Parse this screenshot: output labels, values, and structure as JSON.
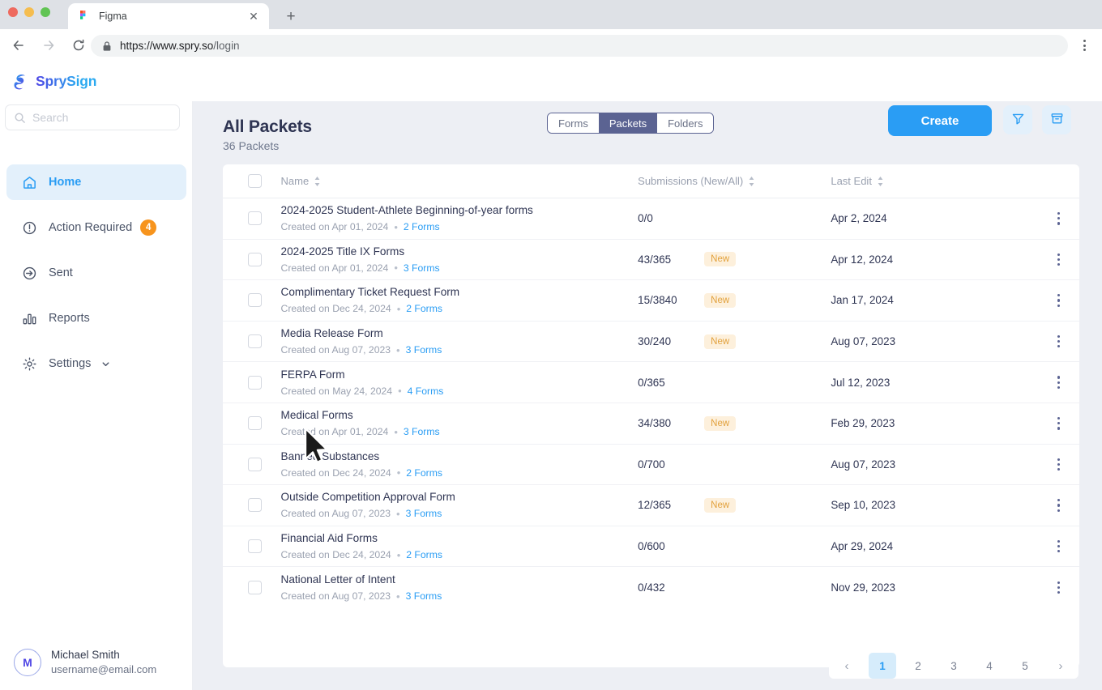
{
  "browser": {
    "tab_title": "Figma",
    "tab_favicon_icon": "figma-icon",
    "close_icon": "close-icon",
    "newtab_icon": "plus-icon",
    "back_icon": "back-arrow-icon",
    "forward_icon": "forward-arrow-icon",
    "reload_icon": "reload-icon",
    "lock_icon": "lock-icon",
    "url_prefix": "https://www.spry.so",
    "url_path": "/login",
    "menu_icon": "browser-menu-icon"
  },
  "app": {
    "brand": "SprySign",
    "brand_icon": "sprysign-logo-icon"
  },
  "sidebar": {
    "search": {
      "placeholder": "Search",
      "value": "",
      "icon": "search-icon"
    },
    "items": [
      {
        "label": "Home",
        "icon": "home-icon",
        "active": true,
        "badge": null
      },
      {
        "label": "Action Required",
        "icon": "alert-circle-icon",
        "active": false,
        "badge": "4"
      },
      {
        "label": "Sent",
        "icon": "send-arrow-icon",
        "active": false,
        "badge": null
      },
      {
        "label": "Reports",
        "icon": "bar-chart-icon",
        "active": false,
        "badge": null
      },
      {
        "label": "Settings",
        "icon": "gear-icon",
        "active": false,
        "badge": null,
        "chevron": "chevron-down-icon"
      }
    ],
    "user": {
      "initial": "M",
      "name": "Michael Smith",
      "email": "username@email.com"
    }
  },
  "main": {
    "title": "All Packets",
    "subtitle": "36 Packets",
    "segments": [
      {
        "label": "Forms",
        "active": false
      },
      {
        "label": "Packets",
        "active": true
      },
      {
        "label": "Folders",
        "active": false
      }
    ],
    "create_label": "Create",
    "filter_icon": "filter-funnel-icon",
    "archive_icon": "archive-box-icon",
    "columns": {
      "name": "Name",
      "submissions": "Submissions (New/All)",
      "last_edit": "Last Edit",
      "sort_icon": "sort-updown-icon",
      "select_all_icon": "checkbox-icon",
      "row_menu_icon": "kebab-menu-icon"
    },
    "rows": [
      {
        "name": "2024-2025 Student-Athlete Beginning-of-year forms",
        "created": "Created on Apr 01, 2024",
        "forms": "2 Forms",
        "submissions": "0/0",
        "new": false,
        "last_edit": "Apr 2, 2024"
      },
      {
        "name": "2024-2025 Title IX Forms",
        "created": "Created on Apr 01, 2024",
        "forms": "3 Forms",
        "submissions": "43/365",
        "new": true,
        "last_edit": "Apr 12, 2024"
      },
      {
        "name": "Complimentary Ticket Request Form",
        "created": "Created on Dec 24, 2024",
        "forms": "2 Forms",
        "submissions": "15/3840",
        "new": true,
        "last_edit": "Jan 17, 2024"
      },
      {
        "name": "Media Release Form",
        "created": "Created on Aug 07, 2023",
        "forms": "3 Forms",
        "submissions": "30/240",
        "new": true,
        "last_edit": "Aug 07, 2023"
      },
      {
        "name": "FERPA Form",
        "created": "Created on May 24, 2024",
        "forms": "4 Forms",
        "submissions": "0/365",
        "new": false,
        "last_edit": "Jul 12, 2023"
      },
      {
        "name": "Medical Forms",
        "created": "Created on Apr 01, 2024",
        "forms": "3 Forms",
        "submissions": "34/380",
        "new": true,
        "last_edit": "Feb 29, 2023"
      },
      {
        "name": "Banned Substances",
        "created": "Created on Dec 24, 2024",
        "forms": "2 Forms",
        "submissions": "0/700",
        "new": false,
        "last_edit": "Aug 07, 2023"
      },
      {
        "name": "Outside Competition Approval Form",
        "created": "Created on Aug 07, 2023",
        "forms": "3 Forms",
        "submissions": "12/365",
        "new": true,
        "last_edit": "Sep 10, 2023"
      },
      {
        "name": "Financial Aid Forms",
        "created": "Created on Dec 24, 2024",
        "forms": "2 Forms",
        "submissions": "0/600",
        "new": false,
        "last_edit": "Apr 29, 2024"
      },
      {
        "name": "National Letter of Intent",
        "created": "Created on Aug 07, 2023",
        "forms": "3 Forms",
        "submissions": "0/432",
        "new": false,
        "last_edit": "Nov 29, 2023"
      }
    ],
    "new_badge_label": "New",
    "pagination": {
      "prev_icon": "chevron-left-icon",
      "next_icon": "chevron-right-icon",
      "pages": [
        "1",
        "2",
        "3",
        "4",
        "5"
      ],
      "current": "1"
    }
  },
  "colors": {
    "accent_blue": "#2a9df4",
    "segment_active": "#5b6392",
    "badge_orange": "#f7941d",
    "new_badge_bg": "#fdf0dc",
    "new_badge_text": "#e2a13c",
    "main_bg": "#edeff4",
    "text_dark": "#2f3553"
  }
}
